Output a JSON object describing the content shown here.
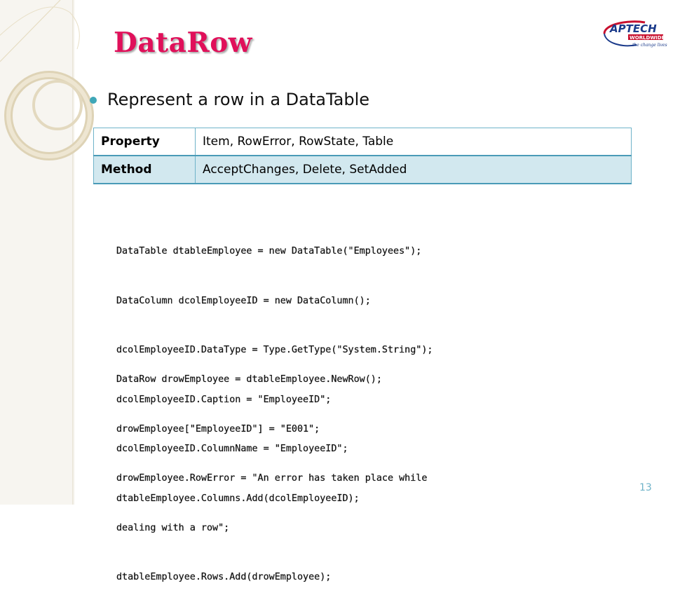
{
  "slide": {
    "title": "DataRow",
    "bullet": "Represent a row in a DataTable",
    "page_number": "13"
  },
  "logo": {
    "name": "APTECH",
    "sub": "WORLDWIDE",
    "tagline": "the change lives"
  },
  "table": {
    "rows": [
      {
        "key": "Property",
        "value": "Item, RowError, RowState, Table"
      },
      {
        "key": "Method",
        "value": "AcceptChanges, Delete, SetAdded"
      }
    ]
  },
  "code": {
    "block1": [
      "DataTable dtableEmployee = new DataTable(\"Employees\");",
      "DataColumn dcolEmployeeID = new DataColumn();",
      "dcolEmployeeID.DataType = Type.GetType(\"System.String\");",
      "dcolEmployeeID.Caption = \"EmployeeID\";",
      "dcolEmployeeID.ColumnName = \"EmployeeID\";",
      "dtableEmployee.Columns.Add(dcolEmployeeID);"
    ],
    "block2": [
      "DataRow drowEmployee = dtableEmployee.NewRow();",
      "drowEmployee[\"EmployeeID\"] = \"E001\";",
      "drowEmployee.RowError = \"An error has taken place while",
      "dealing with a row\";",
      "dtableEmployee.Rows.Add(drowEmployee);"
    ]
  },
  "colors": {
    "title": "#e0105a",
    "accent": "#3fa7b8",
    "table_border": "#4a9bb7",
    "table_alt_row": "#d2e8ef",
    "logo_red": "#c8102e"
  }
}
